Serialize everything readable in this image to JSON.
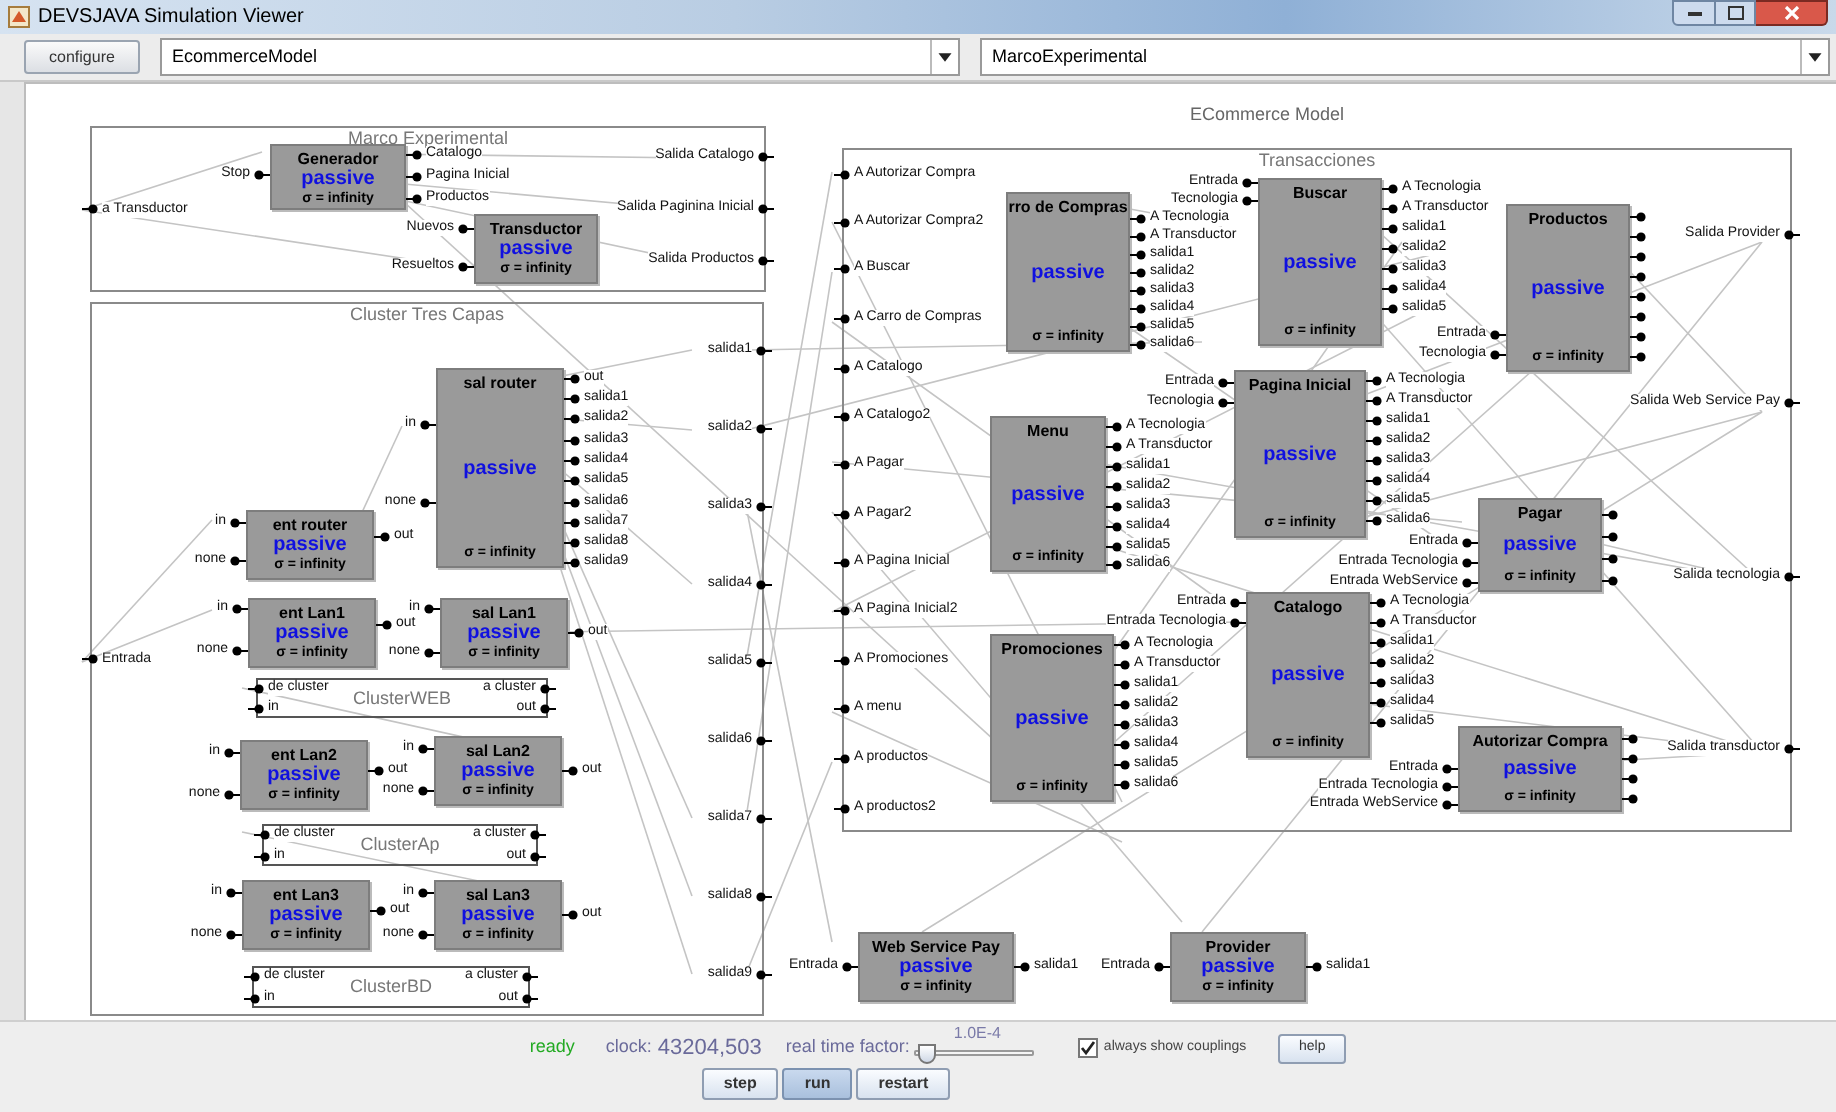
{
  "window": {
    "title": "DEVSJAVA Simulation Viewer"
  },
  "toolbar": {
    "configure_button": "configure",
    "model_select": "EcommerceModel",
    "component_select": "MarcoExperimental"
  },
  "diagram": {
    "title": "ECommerce Model",
    "coupled_models": [
      {
        "title": "Marco Experimental",
        "in_ports": [
          "a Transductor"
        ],
        "out_ports": [
          "Salida Catalogo",
          "Salida Paginina Inicial",
          "Salida Productos"
        ]
      },
      {
        "title": "Cluster Tres Capas",
        "in_ports": [
          "Entrada"
        ],
        "out_ports": [
          "salida1",
          "salida2",
          "salida3",
          "salida4",
          "salida5",
          "salida6",
          "salida7",
          "salida8",
          "salida9"
        ]
      },
      {
        "title": "ClusterWEB",
        "in_ports": [
          "de cluster",
          "in"
        ],
        "out_ports": [
          "a cluster",
          "out"
        ]
      },
      {
        "title": "ClusterAp",
        "in_ports": [
          "de cluster",
          "in"
        ],
        "out_ports": [
          "a cluster",
          "out"
        ]
      },
      {
        "title": "ClusterBD",
        "in_ports": [
          "de cluster",
          "in"
        ],
        "out_ports": [
          "a cluster",
          "out"
        ]
      },
      {
        "title": "Transacciones",
        "in_ports": [
          "A Autorizar Compra",
          "A Autorizar Compra2",
          "A Buscar",
          "A Carro de Compras",
          "A Catalogo",
          "A Catalogo2",
          "A Pagar",
          "A Pagar2",
          "A Pagina Inicial",
          "A Pagina Inicial2",
          "A Promociones",
          "A menu",
          "A productos",
          "A productos2"
        ],
        "out_ports": [
          "Salida Provider",
          "Salida Web Service Pay",
          "Salida tecnologia",
          "Salida transductor"
        ]
      }
    ],
    "atomic_models": [
      {
        "name": "Generador",
        "phase": "passive",
        "sigma": "σ = infinity",
        "in_ports": [
          "Stop"
        ],
        "out_ports": [
          "Catalogo",
          "Pagina Inicial",
          "Productos"
        ]
      },
      {
        "name": "Transductor",
        "phase": "passive",
        "sigma": "σ = infinity",
        "in_ports": [
          "Nuevos",
          "Resueltos"
        ]
      },
      {
        "name": "sal router",
        "phase": "passive",
        "sigma": "σ = infinity",
        "in_ports": [
          "in",
          "none"
        ],
        "out_ports": [
          "out",
          "salida1",
          "salida2",
          "salida3",
          "salida4",
          "salida5",
          "salida6",
          "salida7",
          "salida8",
          "salida9"
        ]
      },
      {
        "name": "ent router",
        "phase": "passive",
        "sigma": "σ = infinity",
        "in_ports": [
          "in",
          "none"
        ],
        "out_ports": [
          "out"
        ]
      },
      {
        "name": "ent Lan1",
        "phase": "passive",
        "sigma": "σ = infinity",
        "in_ports": [
          "in",
          "none"
        ],
        "out_ports": [
          "out"
        ]
      },
      {
        "name": "sal Lan1",
        "phase": "passive",
        "sigma": "σ = infinity",
        "in_ports": [
          "in",
          "none"
        ],
        "out_ports": [
          "out"
        ]
      },
      {
        "name": "ent Lan2",
        "phase": "passive",
        "sigma": "σ = infinity",
        "in_ports": [
          "in",
          "none"
        ],
        "out_ports": [
          "out"
        ]
      },
      {
        "name": "sal Lan2",
        "phase": "passive",
        "sigma": "σ = infinity",
        "in_ports": [
          "in",
          "none"
        ],
        "out_ports": [
          "out"
        ]
      },
      {
        "name": "ent Lan3",
        "phase": "passive",
        "sigma": "σ = infinity",
        "in_ports": [
          "in",
          "none"
        ],
        "out_ports": [
          "out"
        ]
      },
      {
        "name": "sal Lan3",
        "phase": "passive",
        "sigma": "σ = infinity",
        "in_ports": [
          "in",
          "none"
        ],
        "out_ports": [
          "out"
        ]
      },
      {
        "name": "rro de Compras",
        "phase": "passive",
        "sigma": "σ = infinity",
        "out_ports": [
          "A Tecnologia",
          "A Transductor",
          "salida1",
          "salida2",
          "salida3",
          "salida4",
          "salida5",
          "salida6"
        ]
      },
      {
        "name": "Buscar",
        "phase": "passive",
        "sigma": "σ = infinity",
        "in_ports": [
          "Entrada",
          "Tecnologia"
        ],
        "out_ports": [
          "A Tecnologia",
          "A Transductor",
          "salida1",
          "salida2",
          "salida3",
          "salida4",
          "salida5"
        ]
      },
      {
        "name": "Productos",
        "phase": "passive",
        "sigma": "σ = infinity",
        "in_ports": [
          "Entrada",
          "Tecnologia"
        ],
        "out_ports": [
          {
            "kind": "bare"
          },
          {
            "kind": "bare"
          },
          {
            "kind": "bare"
          },
          {
            "kind": "bare"
          },
          {
            "kind": "bare"
          },
          {
            "kind": "bare"
          },
          {
            "kind": "bare"
          },
          {
            "kind": "bare"
          }
        ]
      },
      {
        "name": "Pagina Inicial",
        "phase": "passive",
        "sigma": "σ = infinity",
        "in_ports": [
          "Entrada",
          "Tecnologia"
        ],
        "out_ports": [
          "A Tecnologia",
          "A Transductor",
          "salida1",
          "salida2",
          "salida3",
          "salida4",
          "salida5",
          "salida6"
        ]
      },
      {
        "name": "Menu",
        "phase": "passive",
        "sigma": "σ = infinity",
        "out_ports": [
          "A Tecnologia",
          "A Transductor",
          "salida1",
          "salida2",
          "salida3",
          "salida4",
          "salida5",
          "salida6"
        ]
      },
      {
        "name": "Pagar",
        "phase": "passive",
        "sigma": "σ = infinity",
        "in_ports": [
          "Entrada",
          "Entrada Tecnologia",
          "Entrada WebService"
        ],
        "out_ports": [
          {
            "kind": "bare"
          },
          {
            "kind": "bare"
          },
          {
            "kind": "bare"
          },
          {
            "kind": "bare"
          }
        ]
      },
      {
        "name": "Catalogo",
        "phase": "passive",
        "sigma": "σ = infinity",
        "in_ports": [
          "Entrada",
          "Entrada Tecnologia"
        ],
        "out_ports": [
          "A Tecnologia",
          "A Transductor",
          "salida1",
          "salida2",
          "salida3",
          "salida4",
          "salida5"
        ]
      },
      {
        "name": "Promociones",
        "phase": "passive",
        "sigma": "σ = infinity",
        "out_ports": [
          "A Tecnologia",
          "A Transductor",
          "salida1",
          "salida2",
          "salida3",
          "salida4",
          "salida5",
          "salida6"
        ]
      },
      {
        "name": "Autorizar Compra",
        "phase": "passive",
        "sigma": "σ = infinity",
        "in_ports": [
          "Entrada",
          "Entrada Tecnologia",
          "Entrada WebService"
        ],
        "out_ports": [
          {
            "kind": "bare"
          },
          {
            "kind": "bare"
          },
          {
            "kind": "bare"
          },
          {
            "kind": "bare"
          }
        ]
      },
      {
        "name": "Web Service Pay",
        "phase": "passive",
        "sigma": "σ = infinity",
        "in_ports": [
          "Entrada"
        ],
        "out_ports": [
          "salida1"
        ]
      },
      {
        "name": "Provider",
        "phase": "passive",
        "sigma": "σ = infinity",
        "in_ports": [
          "Entrada"
        ],
        "out_ports": [
          "salida1"
        ]
      }
    ]
  },
  "status_bar": {
    "status": "ready",
    "clock_label": "clock:",
    "clock_value": "43204,503",
    "rate_label": "real time factor:",
    "rate_value": "1.0E-4",
    "rate_slider": {
      "level": 0.05
    },
    "couplings_checkbox": {
      "label": "always show couplings",
      "checked": true
    },
    "help_button": "help",
    "buttons": [
      {
        "label": "step",
        "selected": false
      },
      {
        "label": "run",
        "selected": true
      },
      {
        "label": "restart",
        "selected": false
      }
    ]
  }
}
